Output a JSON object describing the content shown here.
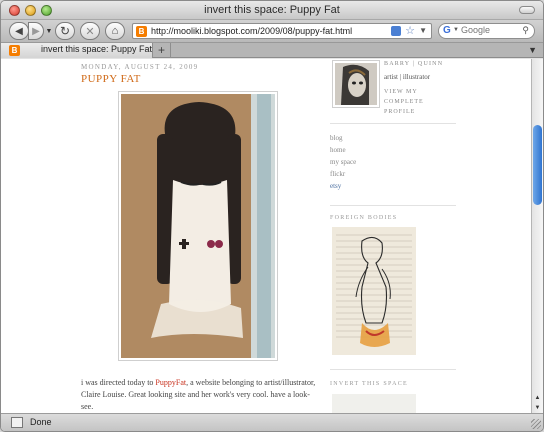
{
  "window": {
    "title": "invert this space: Puppy Fat"
  },
  "toolbar": {
    "url": "http://mooliki.blogspot.com/2009/08/puppy-fat.html",
    "search_placeholder": "Google",
    "back_icon": "back-arrow-icon",
    "forward_icon": "forward-arrow-icon",
    "reload_icon": "reload-icon",
    "stop_icon": "stop-icon",
    "home_icon": "home-icon"
  },
  "tabs": [
    {
      "label": "invert this space: Puppy Fat",
      "active": true
    }
  ],
  "post": {
    "date": "Monday, August 24, 2009",
    "title": "PUPPY FAT",
    "body_before": "i was directed today to ",
    "link": "PuppyFat",
    "body_after": ", a website belonging to artist/illustrator, Claire Louise. Great looking site and her work's very cool. have a look-see."
  },
  "profile": {
    "name": "BARRY | QUINN",
    "description": "artist | illustrator",
    "link": "VIEW MY COMPLETE PROFILE"
  },
  "sidebar": {
    "links": [
      {
        "label": "blog",
        "active": false
      },
      {
        "label": "home",
        "active": false
      },
      {
        "label": "my space",
        "active": false
      },
      {
        "label": "flickr",
        "active": false
      },
      {
        "label": "etsy",
        "active": true
      }
    ],
    "section1_heading": "FOREIGN BODIES",
    "section2_heading": "INVERT THIS SPACE"
  },
  "status": {
    "text": "Done"
  },
  "colors": {
    "title_accent": "#d06a18",
    "link_red": "#c9321f",
    "link_blue": "#4a6ea0",
    "scroll_blue": "#2f74d0"
  }
}
